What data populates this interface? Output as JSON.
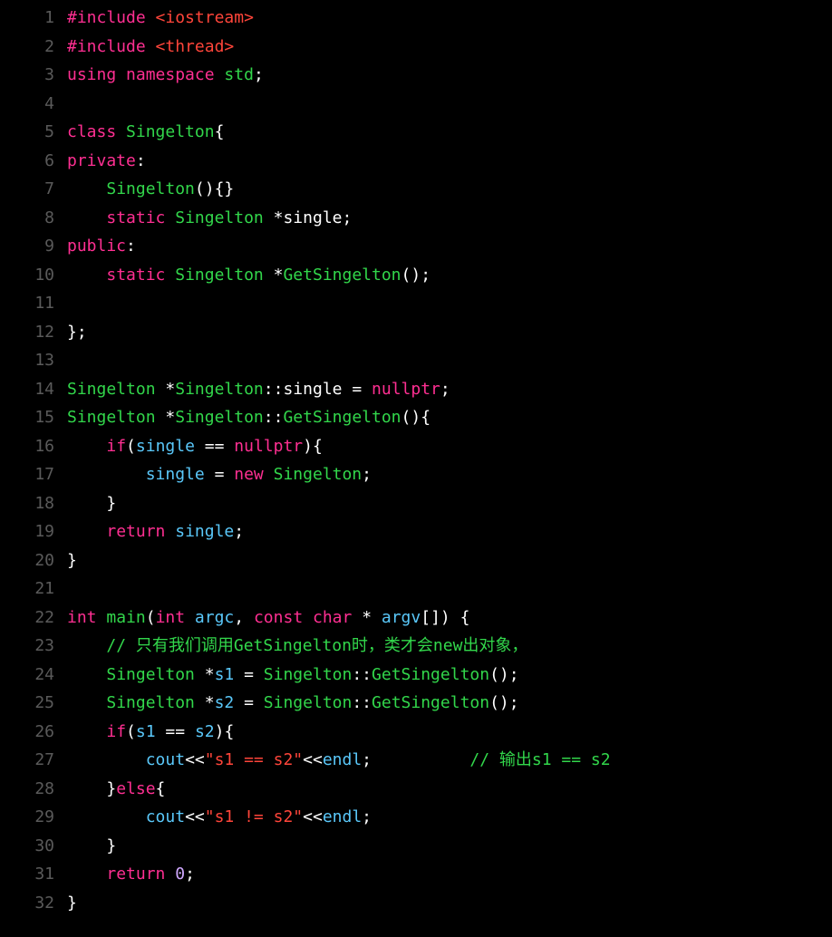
{
  "lines": [
    {
      "n": 1,
      "tokens": [
        [
          "pp",
          "#include "
        ],
        [
          "incb",
          "<iostream>"
        ]
      ]
    },
    {
      "n": 2,
      "tokens": [
        [
          "pp",
          "#include "
        ],
        [
          "incb",
          "<thread>"
        ]
      ]
    },
    {
      "n": 3,
      "tokens": [
        [
          "kw",
          "using"
        ],
        [
          "op",
          " "
        ],
        [
          "kw",
          "namespace"
        ],
        [
          "op",
          " "
        ],
        [
          "type",
          "std"
        ],
        [
          "op",
          ";"
        ]
      ]
    },
    {
      "n": 4,
      "tokens": [
        [
          "op",
          ""
        ]
      ]
    },
    {
      "n": 5,
      "tokens": [
        [
          "kw",
          "class"
        ],
        [
          "op",
          " "
        ],
        [
          "type",
          "Singelton"
        ],
        [
          "op",
          "{"
        ]
      ]
    },
    {
      "n": 6,
      "tokens": [
        [
          "kw",
          "private"
        ],
        [
          "op",
          ":"
        ]
      ]
    },
    {
      "n": 7,
      "tokens": [
        [
          "op",
          "    "
        ],
        [
          "type",
          "Singelton"
        ],
        [
          "op",
          "(){}"
        ]
      ]
    },
    {
      "n": 8,
      "tokens": [
        [
          "op",
          "    "
        ],
        [
          "kw",
          "static"
        ],
        [
          "op",
          " "
        ],
        [
          "type",
          "Singelton"
        ],
        [
          "op",
          " *"
        ],
        [
          "id",
          "single"
        ],
        [
          "op",
          ";"
        ]
      ]
    },
    {
      "n": 9,
      "tokens": [
        [
          "kw",
          "public"
        ],
        [
          "op",
          ":"
        ]
      ]
    },
    {
      "n": 10,
      "tokens": [
        [
          "op",
          "    "
        ],
        [
          "kw",
          "static"
        ],
        [
          "op",
          " "
        ],
        [
          "type",
          "Singelton"
        ],
        [
          "op",
          " *"
        ],
        [
          "fn",
          "GetSingelton"
        ],
        [
          "op",
          "();"
        ]
      ]
    },
    {
      "n": 11,
      "tokens": [
        [
          "op",
          ""
        ]
      ]
    },
    {
      "n": 12,
      "tokens": [
        [
          "op",
          "};"
        ]
      ]
    },
    {
      "n": 13,
      "tokens": [
        [
          "op",
          ""
        ]
      ]
    },
    {
      "n": 14,
      "tokens": [
        [
          "type",
          "Singelton"
        ],
        [
          "op",
          " *"
        ],
        [
          "type",
          "Singelton"
        ],
        [
          "op",
          "::"
        ],
        [
          "id",
          "single"
        ],
        [
          "op",
          " = "
        ],
        [
          "kw",
          "nullptr"
        ],
        [
          "op",
          ";"
        ]
      ]
    },
    {
      "n": 15,
      "tokens": [
        [
          "type",
          "Singelton"
        ],
        [
          "op",
          " *"
        ],
        [
          "type",
          "Singelton"
        ],
        [
          "op",
          "::"
        ],
        [
          "fn",
          "GetSingelton"
        ],
        [
          "op",
          "(){"
        ]
      ]
    },
    {
      "n": 16,
      "tokens": [
        [
          "op",
          "    "
        ],
        [
          "kw",
          "if"
        ],
        [
          "op",
          "("
        ],
        [
          "var",
          "single"
        ],
        [
          "op",
          " == "
        ],
        [
          "kw",
          "nullptr"
        ],
        [
          "op",
          "){"
        ]
      ]
    },
    {
      "n": 17,
      "tokens": [
        [
          "op",
          "        "
        ],
        [
          "var",
          "single"
        ],
        [
          "op",
          " = "
        ],
        [
          "kw",
          "new"
        ],
        [
          "op",
          " "
        ],
        [
          "type",
          "Singelton"
        ],
        [
          "op",
          ";"
        ]
      ]
    },
    {
      "n": 18,
      "tokens": [
        [
          "op",
          "    }"
        ]
      ]
    },
    {
      "n": 19,
      "tokens": [
        [
          "op",
          "    "
        ],
        [
          "kw",
          "return"
        ],
        [
          "op",
          " "
        ],
        [
          "var",
          "single"
        ],
        [
          "op",
          ";"
        ]
      ]
    },
    {
      "n": 20,
      "tokens": [
        [
          "op",
          "}"
        ]
      ]
    },
    {
      "n": 21,
      "tokens": [
        [
          "op",
          ""
        ]
      ]
    },
    {
      "n": 22,
      "tokens": [
        [
          "kw",
          "int"
        ],
        [
          "op",
          " "
        ],
        [
          "fn",
          "main"
        ],
        [
          "op",
          "("
        ],
        [
          "kw",
          "int"
        ],
        [
          "op",
          " "
        ],
        [
          "var",
          "argc"
        ],
        [
          "op",
          ", "
        ],
        [
          "kw",
          "const"
        ],
        [
          "op",
          " "
        ],
        [
          "kw",
          "char"
        ],
        [
          "op",
          " * "
        ],
        [
          "var",
          "argv"
        ],
        [
          "op",
          "[]) {"
        ]
      ]
    },
    {
      "n": 23,
      "tokens": [
        [
          "op",
          "    "
        ],
        [
          "cmt",
          "// 只有我们调用GetSingelton时，类才会new出对象，"
        ]
      ]
    },
    {
      "n": 24,
      "tokens": [
        [
          "op",
          "    "
        ],
        [
          "type",
          "Singelton"
        ],
        [
          "op",
          " *"
        ],
        [
          "var",
          "s1"
        ],
        [
          "op",
          " = "
        ],
        [
          "type",
          "Singelton"
        ],
        [
          "op",
          "::"
        ],
        [
          "fn",
          "GetSingelton"
        ],
        [
          "op",
          "();"
        ]
      ]
    },
    {
      "n": 25,
      "tokens": [
        [
          "op",
          "    "
        ],
        [
          "type",
          "Singelton"
        ],
        [
          "op",
          " *"
        ],
        [
          "var",
          "s2"
        ],
        [
          "op",
          " = "
        ],
        [
          "type",
          "Singelton"
        ],
        [
          "op",
          "::"
        ],
        [
          "fn",
          "GetSingelton"
        ],
        [
          "op",
          "();"
        ]
      ]
    },
    {
      "n": 26,
      "tokens": [
        [
          "op",
          "    "
        ],
        [
          "kw",
          "if"
        ],
        [
          "op",
          "("
        ],
        [
          "var",
          "s1"
        ],
        [
          "op",
          " == "
        ],
        [
          "var",
          "s2"
        ],
        [
          "op",
          "){"
        ]
      ]
    },
    {
      "n": 27,
      "tokens": [
        [
          "op",
          "        "
        ],
        [
          "var",
          "cout"
        ],
        [
          "op",
          "<<"
        ],
        [
          "str",
          "\"s1 == s2\""
        ],
        [
          "op",
          "<<"
        ],
        [
          "var",
          "endl"
        ],
        [
          "op",
          ";          "
        ],
        [
          "cmt",
          "// 输出s1 == s2"
        ]
      ]
    },
    {
      "n": 28,
      "tokens": [
        [
          "op",
          "    }"
        ],
        [
          "kw",
          "else"
        ],
        [
          "op",
          "{"
        ]
      ]
    },
    {
      "n": 29,
      "tokens": [
        [
          "op",
          "        "
        ],
        [
          "var",
          "cout"
        ],
        [
          "op",
          "<<"
        ],
        [
          "str",
          "\"s1 != s2\""
        ],
        [
          "op",
          "<<"
        ],
        [
          "var",
          "endl"
        ],
        [
          "op",
          ";"
        ]
      ]
    },
    {
      "n": 30,
      "tokens": [
        [
          "op",
          "    }"
        ]
      ]
    },
    {
      "n": 31,
      "tokens": [
        [
          "op",
          "    "
        ],
        [
          "kw",
          "return"
        ],
        [
          "op",
          " "
        ],
        [
          "num",
          "0"
        ],
        [
          "op",
          ";"
        ]
      ]
    },
    {
      "n": 32,
      "tokens": [
        [
          "op",
          "}"
        ]
      ]
    }
  ]
}
